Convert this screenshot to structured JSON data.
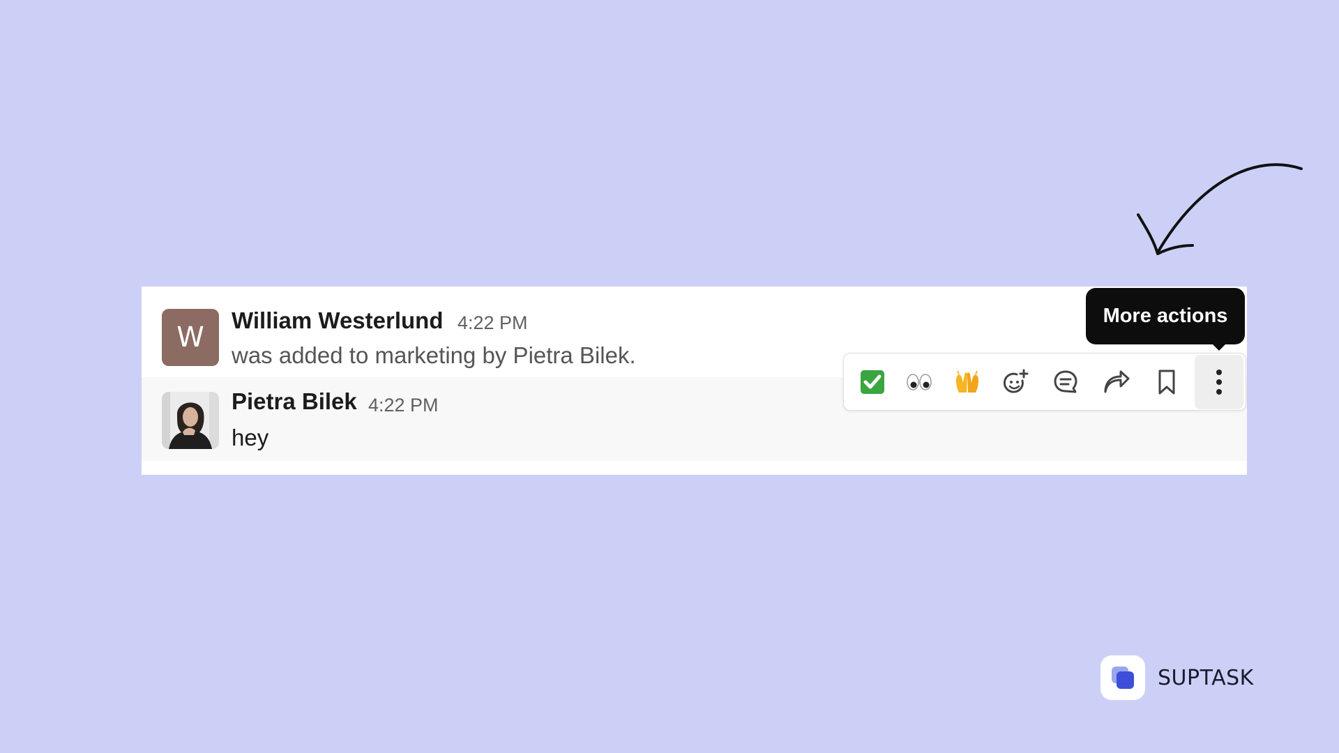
{
  "messages": [
    {
      "author": "William Westerlund",
      "time": "4:22 PM",
      "text": "was added to marketing by Pietra Bilek.",
      "avatar_letter": "W",
      "avatar_color": "#8c6b62"
    },
    {
      "author": "Pietra Bilek",
      "time": "4:22 PM",
      "text": "hey",
      "avatar": "profile-photo"
    }
  ],
  "toolbar": {
    "items": [
      {
        "name": "white-check-mark-reaction",
        "glyph": "✅"
      },
      {
        "name": "eyes-reaction",
        "glyph": "👀"
      },
      {
        "name": "raised-hands-reaction",
        "glyph": "🙌"
      },
      {
        "name": "add-reaction",
        "icon": "emoji-plus-icon"
      },
      {
        "name": "reply-in-thread",
        "icon": "speech-bubble-icon"
      },
      {
        "name": "forward-message",
        "icon": "forward-arrow-icon"
      },
      {
        "name": "save-for-later",
        "icon": "bookmark-icon"
      },
      {
        "name": "more-actions",
        "icon": "vertical-dots-icon"
      }
    ]
  },
  "tooltip": {
    "label": "More actions"
  },
  "brand": {
    "name": "SUPTASK",
    "accent": "#3d4fd8"
  },
  "colors": {
    "background": "#cdd0f6",
    "panel": "#ffffff",
    "hover_row": "#f8f8f8",
    "tooltip": "#0d0d0d"
  }
}
